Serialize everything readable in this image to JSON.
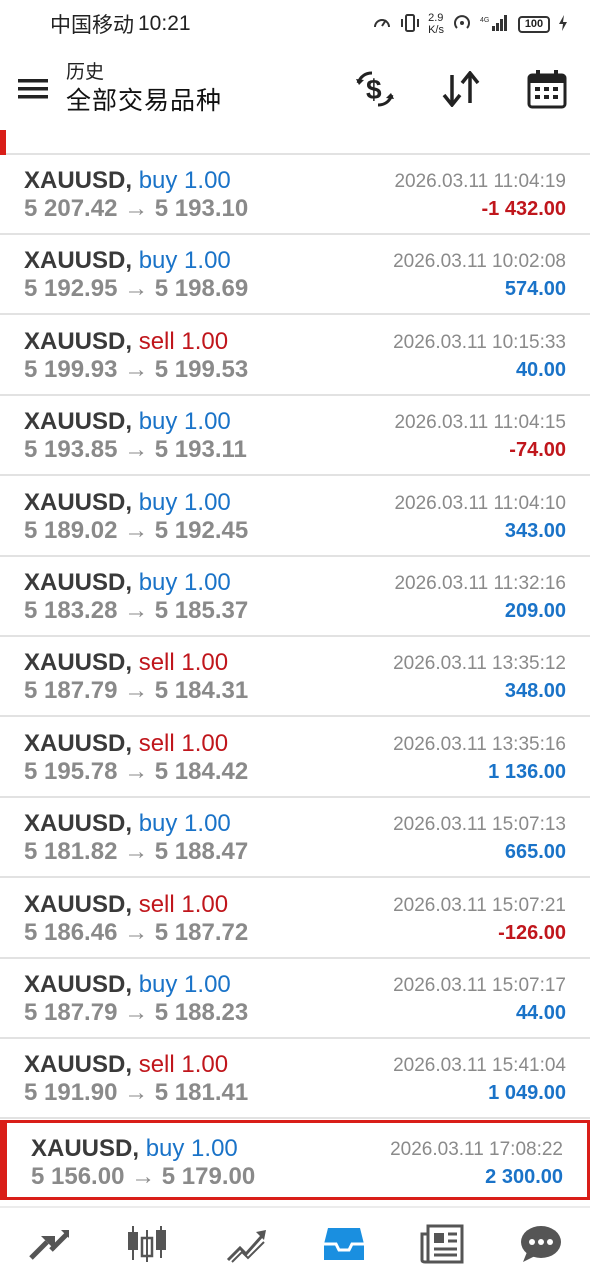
{
  "status_bar": {
    "carrier": "中国移动",
    "time": "10:21",
    "speed_value": "2.9",
    "speed_unit": "K/s",
    "battery": "100"
  },
  "header": {
    "title": "历史",
    "subtitle": "全部交易品种",
    "icons": [
      "menu-icon",
      "currency-exchange-icon",
      "sort-icon",
      "calendar-icon"
    ]
  },
  "trades": [
    {
      "symbol": "XAUUSD,",
      "side": "buy",
      "side_text": "buy 1.00",
      "prices": "5 207.42 → 5 193.10",
      "time": "2026.03.11 11:04:19",
      "profit": "-1 432.00",
      "profit_sign": "neg"
    },
    {
      "symbol": "XAUUSD,",
      "side": "buy",
      "side_text": "buy 1.00",
      "prices": "5 192.95 → 5 198.69",
      "time": "2026.03.11 10:02:08",
      "profit": "574.00",
      "profit_sign": "pos"
    },
    {
      "symbol": "XAUUSD,",
      "side": "sell",
      "side_text": "sell 1.00",
      "prices": "5 199.93 → 5 199.53",
      "time": "2026.03.11 10:15:33",
      "profit": "40.00",
      "profit_sign": "pos"
    },
    {
      "symbol": "XAUUSD,",
      "side": "buy",
      "side_text": "buy 1.00",
      "prices": "5 193.85 → 5 193.11",
      "time": "2026.03.11 11:04:15",
      "profit": "-74.00",
      "profit_sign": "neg"
    },
    {
      "symbol": "XAUUSD,",
      "side": "buy",
      "side_text": "buy 1.00",
      "prices": "5 189.02 → 5 192.45",
      "time": "2026.03.11 11:04:10",
      "profit": "343.00",
      "profit_sign": "pos"
    },
    {
      "symbol": "XAUUSD,",
      "side": "buy",
      "side_text": "buy 1.00",
      "prices": "5 183.28 → 5 185.37",
      "time": "2026.03.11 11:32:16",
      "profit": "209.00",
      "profit_sign": "pos"
    },
    {
      "symbol": "XAUUSD,",
      "side": "sell",
      "side_text": "sell 1.00",
      "prices": "5 187.79 → 5 184.31",
      "time": "2026.03.11 13:35:12",
      "profit": "348.00",
      "profit_sign": "pos"
    },
    {
      "symbol": "XAUUSD,",
      "side": "sell",
      "side_text": "sell 1.00",
      "prices": "5 195.78 → 5 184.42",
      "time": "2026.03.11 13:35:16",
      "profit": "1 136.00",
      "profit_sign": "pos"
    },
    {
      "symbol": "XAUUSD,",
      "side": "buy",
      "side_text": "buy 1.00",
      "prices": "5 181.82 → 5 188.47",
      "time": "2026.03.11 15:07:13",
      "profit": "665.00",
      "profit_sign": "pos"
    },
    {
      "symbol": "XAUUSD,",
      "side": "sell",
      "side_text": "sell 1.00",
      "prices": "5 186.46 → 5 187.72",
      "time": "2026.03.11 15:07:21",
      "profit": "-126.00",
      "profit_sign": "neg"
    },
    {
      "symbol": "XAUUSD,",
      "side": "buy",
      "side_text": "buy 1.00",
      "prices": "5 187.79 → 5 188.23",
      "time": "2026.03.11 15:07:17",
      "profit": "44.00",
      "profit_sign": "pos"
    },
    {
      "symbol": "XAUUSD,",
      "side": "sell",
      "side_text": "sell 1.00",
      "prices": "5 191.90 → 5 181.41",
      "time": "2026.03.11 15:41:04",
      "profit": "1 049.00",
      "profit_sign": "pos"
    },
    {
      "symbol": "XAUUSD,",
      "side": "buy",
      "side_text": "buy 1.00",
      "prices": "5 156.00 → 5 179.00",
      "time": "2026.03.11 17:08:22",
      "profit": "2 300.00",
      "profit_sign": "pos",
      "selected": true
    }
  ],
  "bottom_nav": {
    "tabs": [
      "quotes-icon",
      "chart-icon",
      "trade-icon",
      "history-icon",
      "news-icon",
      "chat-icon"
    ],
    "active": "history-icon",
    "accent_color": "#1a8fe0"
  },
  "colors": {
    "buy": "#1a73c8",
    "sell": "#c0161c",
    "selected_border": "#d91e18"
  }
}
